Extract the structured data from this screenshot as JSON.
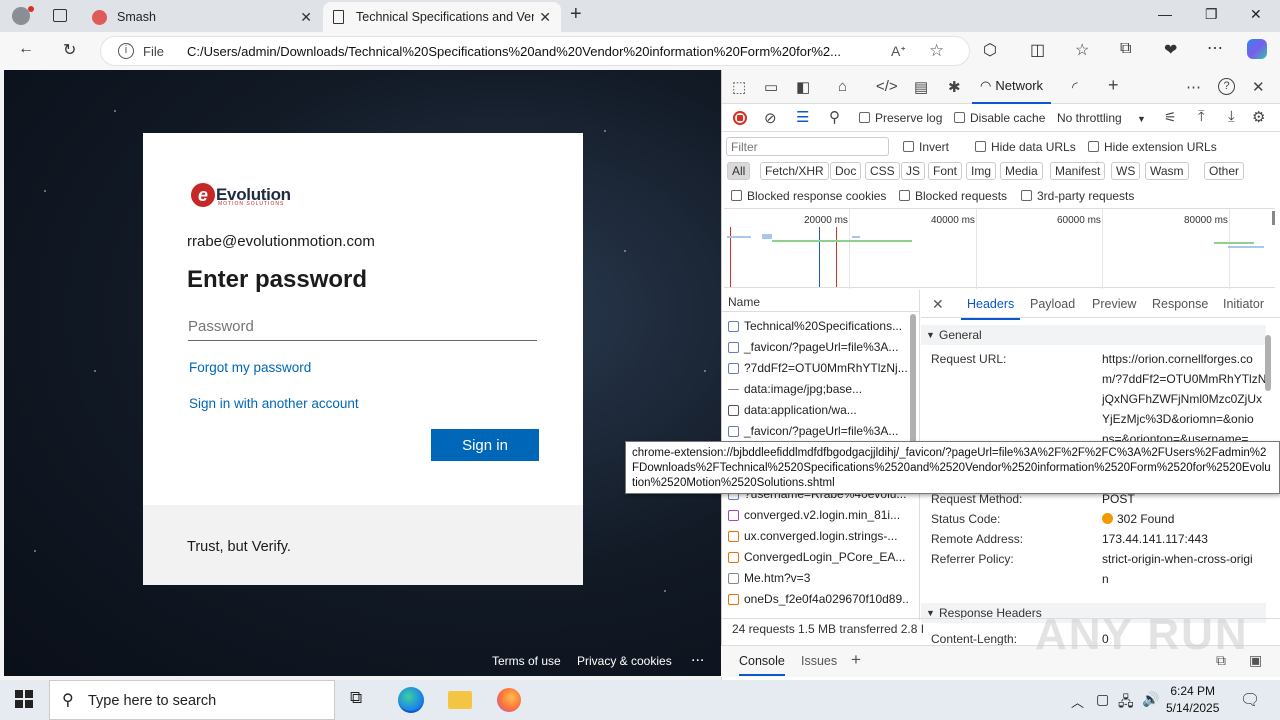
{
  "browser": {
    "tabs": [
      {
        "title": "Smash"
      },
      {
        "title": "Technical Specifications and Vend"
      }
    ],
    "address": {
      "scheme_label": "File",
      "url": "C:/Users/admin/Downloads/Technical%20Specifications%20and%20Vendor%20information%20Form%20for%2..."
    }
  },
  "login": {
    "logo_text": "Evolution",
    "logo_sub": "MOTION SOLUTIONS",
    "email": "rrabe@evolutionmotion.com",
    "heading": "Enter password",
    "password_placeholder": "Password",
    "forgot": "Forgot my password",
    "another": "Sign in with another account",
    "signin": "Sign in",
    "footer_text": "Trust, but Verify.",
    "terms": "Terms of use",
    "privacy": "Privacy & cookies",
    "more": "..."
  },
  "devtools": {
    "active_panel": "Network",
    "preserve_log": "Preserve log",
    "disable_cache": "Disable cache",
    "throttling": "No throttling",
    "filter_placeholder": "Filter",
    "invert": "Invert",
    "hide_data_urls": "Hide data URLs",
    "hide_ext_urls": "Hide extension URLs",
    "types": [
      "All",
      "Fetch/XHR",
      "Doc",
      "CSS",
      "JS",
      "Font",
      "Img",
      "Media",
      "Manifest",
      "WS",
      "Wasm",
      "Other"
    ],
    "blocked_cookies": "Blocked response cookies",
    "blocked_requests": "Blocked requests",
    "third_party": "3rd-party requests",
    "timeline_labels": [
      "20000 ms",
      "40000 ms",
      "60000 ms",
      "80000 ms"
    ],
    "name_header": "Name",
    "requests": [
      "Technical%20Specifications...",
      "_favicon/?pageUrl=file%3A...",
      "?7ddFf2=OTU0MmRhYTlzNj...",
      "data:image/jpg;base...",
      "data:application/wa...",
      "_favicon/?pageUrl=file%3A...",
      "?username=Rrabe%40evolu...",
      "converged.v2.login.min_81i...",
      "ux.converged.login.strings-...",
      "ConvergedLogin_PCore_EA...",
      "Me.htm?v=3",
      "oneDs_f2e0f4a029670f10d89..."
    ],
    "status_bar": "24 requests   1.5 MB transferred   2.8 I",
    "detail_tabs": [
      "Headers",
      "Payload",
      "Preview",
      "Response",
      "Initiator"
    ],
    "general_label": "General",
    "request_url_key": "Request URL:",
    "request_url_lines": [
      "https://orion.cornellforges.co",
      "m/?7ddFf2=OTU0MmRhYTlzN",
      "jQxNGFhZWFjNml0Mzc0ZjUx",
      "YjEzMjc%3D&oriomn=&onio",
      "ns=&orionton=&username="
    ],
    "headers": [
      {
        "k": "Request Method:",
        "v": "POST"
      },
      {
        "k": "Status Code:",
        "v": "302 Found"
      },
      {
        "k": "Remote Address:",
        "v": "173.44.141.117:443"
      },
      {
        "k": "Referrer Policy:",
        "v": "strict-origin-when-cross-origi"
      }
    ],
    "referrer_cont": "n",
    "response_headers_label": "Response Headers",
    "content_length_key": "Content-Length:",
    "content_length_val": "0",
    "tooltip": "chrome-extension://bjbddleefiddlmdfdfbgodgacjjldihj/_favicon/?pageUrl=file%3A%2F%2F%2FC%3A%2FUsers%2Fadmin%2FDownloads%2FTechnical%2520Specifications%2520and%2520Vendor%2520information%2520Form%2520for%2520Evolution%2520Motion%2520Solutions.shtml",
    "console_tab": "Console",
    "issues_tab": "Issues"
  },
  "taskbar": {
    "search_placeholder": "Type here to search",
    "time": "6:24 PM",
    "date": "5/14/2025"
  },
  "watermark": "ANY RUN",
  "colors": {
    "accent": "#0067b8",
    "devtools_blue": "#0b57d0",
    "status_orange": "#f29900"
  }
}
